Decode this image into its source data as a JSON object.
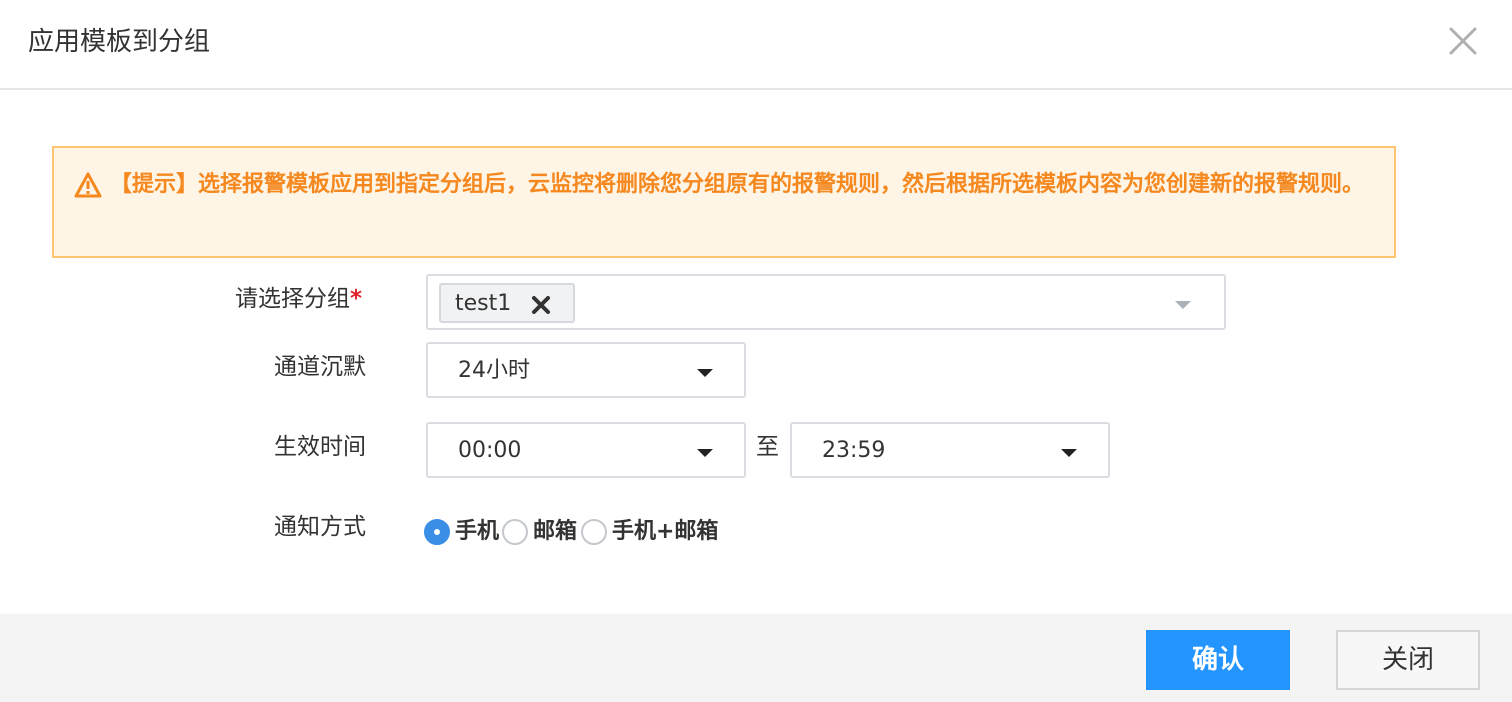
{
  "dialog": {
    "title": "应用模板到分组"
  },
  "warning": {
    "text": "【提示】选择报警模板应用到指定分组后，云监控将删除您分组原有的报警规则，然后根据所选模板内容为您创建新的报警规则。",
    "color": "#f5881f"
  },
  "form": {
    "group": {
      "label": "请选择分组",
      "required_mark": "*",
      "tags": [
        {
          "text": "test1"
        }
      ]
    },
    "silence": {
      "label": "通道沉默",
      "value": "24小时"
    },
    "effective_time": {
      "label": "生效时间",
      "start": "00:00",
      "separator": "至",
      "end": "23:59"
    },
    "notify": {
      "label": "通知方式",
      "options": [
        {
          "label": "手机",
          "checked": true
        },
        {
          "label": "邮箱",
          "checked": false
        },
        {
          "label": "手机+邮箱",
          "checked": false
        }
      ]
    }
  },
  "footer": {
    "confirm_label": "确认",
    "close_label": "关闭",
    "primary_color": "#2495ff"
  }
}
